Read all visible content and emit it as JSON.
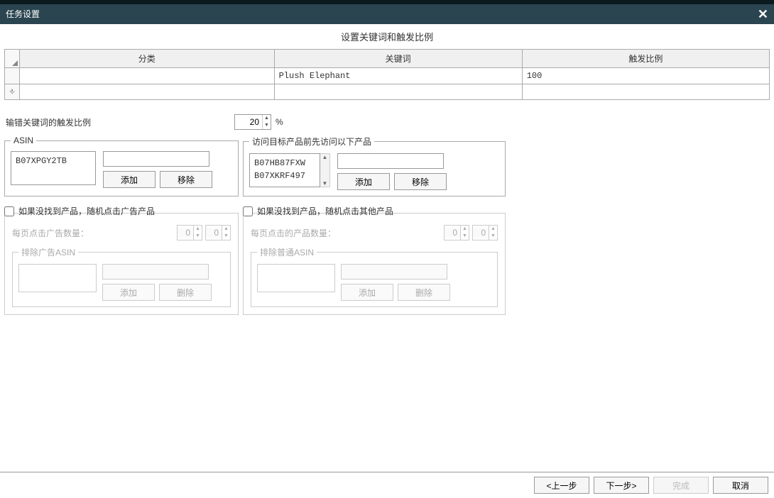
{
  "title": "任务设置",
  "section_title": "设置关键词和触发比例",
  "grid": {
    "headers": {
      "cat": "分类",
      "kw": "关键词",
      "ratio": "触发比例"
    },
    "row": {
      "cat": "",
      "kw": "Plush Elephant",
      "ratio": "100"
    }
  },
  "mistype": {
    "label": "输错关键词的触发比例",
    "value": "20",
    "pct": "%"
  },
  "asin_panel": {
    "legend": "ASIN",
    "items": [
      "B07XPGY2TB"
    ],
    "add": "添加",
    "remove": "移除"
  },
  "visit_panel": {
    "legend": "访问目标产品前先访问以下产品",
    "items": [
      "B07HB87FXW",
      "B07XKRF497"
    ],
    "add": "添加",
    "remove": "移除"
  },
  "ad_group": {
    "checkbox": "如果没找到产品，随机点击广告产品",
    "per_page": "每页点击广告数量：",
    "v1": "0",
    "v2": "0",
    "exclude_legend": "排除广告ASIN",
    "add": "添加",
    "del": "删除"
  },
  "other_group": {
    "checkbox": "如果没找到产品，随机点击其他产品",
    "per_page": "每页点击的产品数量：",
    "v1": "0",
    "v2": "0",
    "exclude_legend": "排除普通ASIN",
    "add": "添加",
    "del": "删除"
  },
  "footer": {
    "prev": "<上一步",
    "next": "下一步>",
    "finish": "完成",
    "cancel": "取消"
  }
}
